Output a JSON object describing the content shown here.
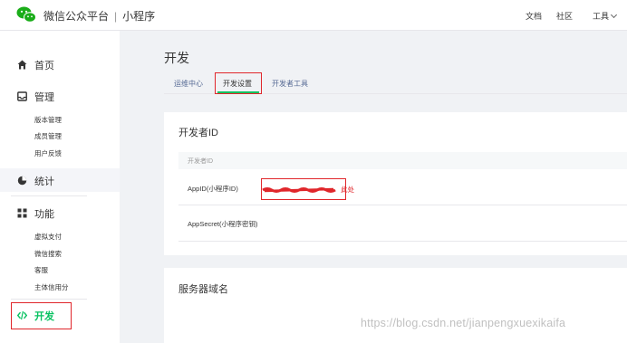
{
  "header": {
    "platform": "微信公众平台",
    "separator": "|",
    "product": "小程序",
    "links": {
      "docs": "文档",
      "community": "社区",
      "tools": "工具"
    }
  },
  "sidebar": {
    "home": "首页",
    "manage": {
      "label": "管理",
      "items": [
        "版本管理",
        "成员管理",
        "用户反馈"
      ]
    },
    "stats": "统计",
    "features": {
      "label": "功能",
      "items": [
        "虚拟支付",
        "微信搜索",
        "客服",
        "主体信用分"
      ]
    },
    "dev": "开发"
  },
  "main": {
    "title": "开发",
    "tabs": [
      "运维中心",
      "开发设置",
      "开发者工具"
    ],
    "active_tab": "开发设置",
    "dev_id_card": {
      "title": "开发者ID",
      "table_header": "开发者ID",
      "rows": [
        {
          "label": "AppID(小程序ID)",
          "note": "此处"
        },
        {
          "label": "AppSecret(小程序密钥)"
        }
      ]
    },
    "server_domain_card": {
      "title": "服务器域名"
    }
  },
  "colors": {
    "accent": "#07c160",
    "annotation": "#e0262b",
    "link": "#576b95"
  },
  "watermark": "https://blog.csdn.net/jianpengxuexikaifa"
}
